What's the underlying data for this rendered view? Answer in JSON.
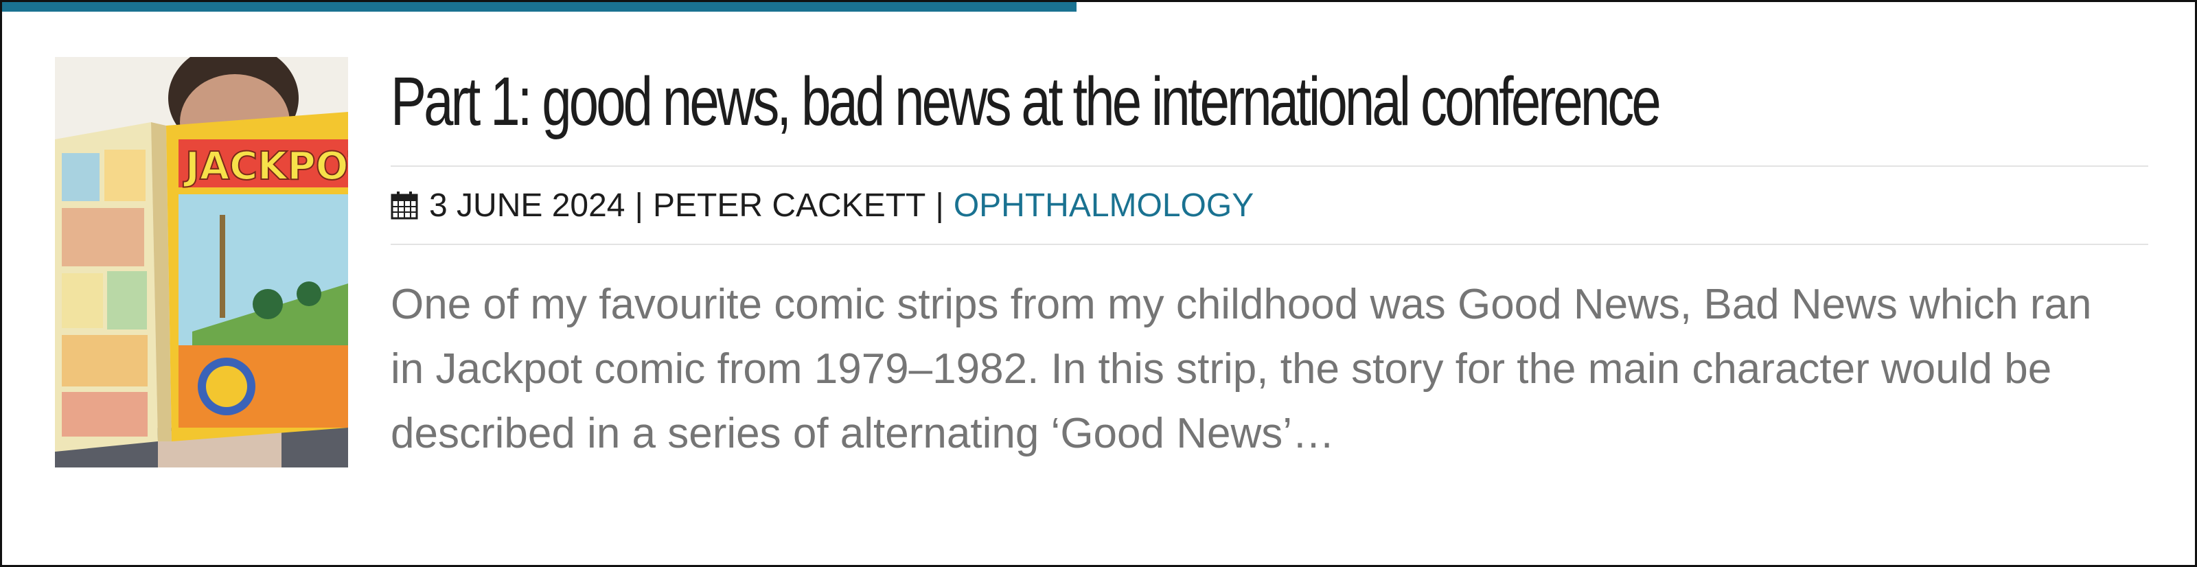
{
  "post": {
    "title": "Part 1: good news, bad news at the international conference",
    "date": "3 JUNE 2024",
    "separator": "|",
    "author": "PETER CACKETT",
    "category": "OPHTHALMOLOGY",
    "excerpt": "One of my favourite comic strips from my childhood was Good News, Bad News which ran in Jackpot comic from 1979–1982. In this strip, the story for the main character would be described in a series of alternating ‘Good News’…",
    "thumbnail_text": "JACKPOT"
  },
  "progress": {
    "fraction": 0.49,
    "color": "#1a7291"
  },
  "colors": {
    "accent": "#1a7291",
    "title": "#1d1d1d",
    "excerpt": "#757575",
    "divider": "#e3e3e3"
  },
  "icons": {
    "date": "calendar-icon"
  }
}
